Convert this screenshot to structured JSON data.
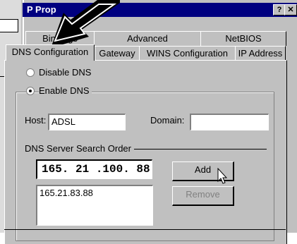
{
  "window": {
    "title": "P Prop",
    "help_label": "?",
    "close_label": "✕"
  },
  "tabs_row1": [
    "Bindings",
    "Advanced",
    "NetBIOS"
  ],
  "tabs_row2": [
    "DNS Configuration",
    "Gateway",
    "WINS Configuration",
    "IP Address"
  ],
  "dns": {
    "disable_label": "Disable DNS",
    "enable_label": "Enable DNS",
    "host_label": "Host:",
    "host_value": "ADSL",
    "domain_label": "Domain:",
    "domain_value": "",
    "search_order_label": "DNS Server Search Order",
    "server_input": "165. 21 .100. 88",
    "servers": [
      "165.21.83.88"
    ],
    "add_label": "Add",
    "remove_label": "Remove"
  },
  "icons": {
    "cursor": "arrow-pointer-icon",
    "pointer": "hand-pointer-icon"
  }
}
